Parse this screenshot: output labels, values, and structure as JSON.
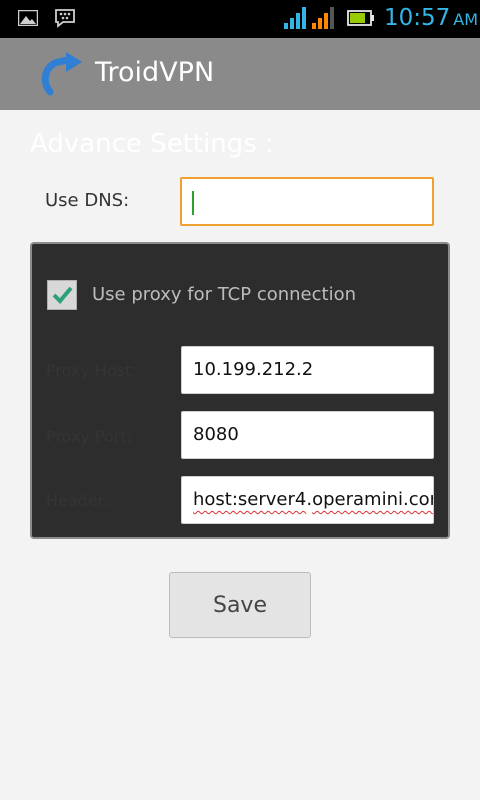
{
  "status_bar": {
    "time": "10:57",
    "ampm": "AM",
    "icons": [
      "gallery-icon",
      "bbm-icon",
      "signal-icon",
      "signal-icon",
      "battery-icon"
    ],
    "colors": {
      "clock": "#33b5e5",
      "signal_1": "#33b5e5",
      "signal_2": "#ff8800",
      "battery": "#99cc00"
    }
  },
  "action_bar": {
    "title": "TroidVPN",
    "icon": "refresh-arrow-icon",
    "background": "#8a8a8a"
  },
  "settings": {
    "section_title": "Advance Settings :",
    "dns": {
      "label": "Use DNS:",
      "value": "",
      "focused": true
    },
    "proxy": {
      "use_proxy_label": "Use proxy for TCP connection",
      "use_proxy_checked": true,
      "host": {
        "label": "Proxy Host:",
        "value": "10.199.212.2"
      },
      "port": {
        "label": "Proxy Port:",
        "value": "8080"
      },
      "header": {
        "label": "Header:",
        "value_part1": "host:server4",
        "value_part2": ".",
        "value_part3": "operamini.com"
      }
    },
    "save_label": "Save"
  }
}
